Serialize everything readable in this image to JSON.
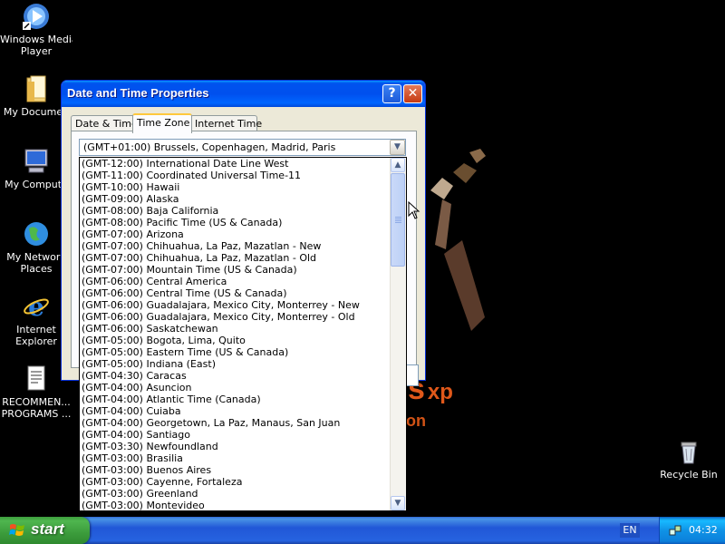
{
  "desktop": {
    "icons": [
      {
        "label_lines": [
          "Windows Media",
          "Player"
        ],
        "icon": "media-player-icon"
      },
      {
        "label_lines": [
          "My Documen"
        ],
        "icon": "folder-icon"
      },
      {
        "label_lines": [
          "My Compute"
        ],
        "icon": "computer-icon"
      },
      {
        "label_lines": [
          "My Network",
          "Places"
        ],
        "icon": "network-globe-icon"
      },
      {
        "label_lines": [
          "Internet",
          "Explorer"
        ],
        "icon": "internet-explorer-icon"
      },
      {
        "label_lines": [
          "RECOMMEN...",
          "PROGRAMS ..."
        ],
        "icon": "text-document-icon"
      },
      {
        "label_lines": [
          "Recycle Bin"
        ],
        "icon": "recycle-bin-icon"
      }
    ],
    "wallpaper_logo": "s",
    "wallpaper_logo_suffix": "xp",
    "wallpaper_logo_line2": "on"
  },
  "dialog": {
    "title": "Date and Time Properties",
    "help_label": "?",
    "close_label": "✕",
    "tabs": [
      {
        "label": "Date & Time",
        "active": false
      },
      {
        "label": "Time Zone",
        "active": true
      },
      {
        "label": "Internet Time",
        "active": false
      }
    ],
    "timezone_select": {
      "selected": "(GMT+01:00) Brussels, Copenhagen, Madrid, Paris",
      "options": [
        "(GMT-12:00) International Date Line West",
        "(GMT-11:00) Coordinated Universal Time-11",
        "(GMT-10:00) Hawaii",
        "(GMT-09:00) Alaska",
        "(GMT-08:00) Baja California",
        "(GMT-08:00) Pacific Time (US & Canada)",
        "(GMT-07:00) Arizona",
        "(GMT-07:00) Chihuahua, La Paz, Mazatlan - New",
        "(GMT-07:00) Chihuahua, La Paz, Mazatlan - Old",
        "(GMT-07:00) Mountain Time (US & Canada)",
        "(GMT-06:00) Central America",
        "(GMT-06:00) Central Time (US & Canada)",
        "(GMT-06:00) Guadalajara, Mexico City, Monterrey - New",
        "(GMT-06:00) Guadalajara, Mexico City, Monterrey - Old",
        "(GMT-06:00) Saskatchewan",
        "(GMT-05:00) Bogota, Lima, Quito",
        "(GMT-05:00) Eastern Time (US & Canada)",
        "(GMT-05:00) Indiana (East)",
        "(GMT-04:30) Caracas",
        "(GMT-04:00) Asuncion",
        "(GMT-04:00) Atlantic Time (Canada)",
        "(GMT-04:00) Cuiaba",
        "(GMT-04:00) Georgetown, La Paz, Manaus, San Juan",
        "(GMT-04:00) Santiago",
        "(GMT-03:30) Newfoundland",
        "(GMT-03:00) Brasilia",
        "(GMT-03:00) Buenos Aires",
        "(GMT-03:00) Cayenne, Fortaleza",
        "(GMT-03:00) Greenland",
        "(GMT-03:00) Montevideo"
      ]
    }
  },
  "taskbar": {
    "start_label": "start",
    "language": "EN",
    "clock": "04:32"
  },
  "colors": {
    "titlebar_blue": "#0053ee",
    "start_green": "#3c9c3c",
    "dialog_face": "#ece9d8",
    "wallpaper_orange": "#e0581a"
  }
}
